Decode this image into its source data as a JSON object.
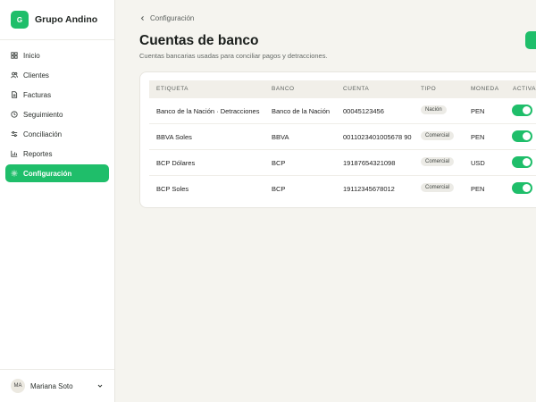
{
  "brand": {
    "logo_letter": "G",
    "name": "Grupo Andino",
    "accent": "#1fbe6a"
  },
  "sidebar": {
    "items": [
      {
        "label": "Inicio",
        "icon": "grid-icon",
        "active": false
      },
      {
        "label": "Clientes",
        "icon": "users-icon",
        "active": false
      },
      {
        "label": "Facturas",
        "icon": "file-icon",
        "active": false
      },
      {
        "label": "Seguimiento",
        "icon": "clock-icon",
        "active": false
      },
      {
        "label": "Conciliación",
        "icon": "sliders-icon",
        "active": false
      },
      {
        "label": "Reportes",
        "icon": "bar-chart-icon",
        "active": false
      },
      {
        "label": "Configuración",
        "icon": "gear-icon",
        "active": true
      }
    ],
    "user": {
      "initials": "MA",
      "name": "Mariana Soto"
    }
  },
  "header": {
    "breadcrumb": "Configuración",
    "title": "Cuentas de banco",
    "subtitle": "Cuentas bancarias usadas para conciliar pagos y detracciones."
  },
  "table": {
    "columns": [
      "ETIQUETA",
      "BANCO",
      "CUENTA",
      "TIPO",
      "MONEDA",
      "ACTIVA"
    ],
    "rows": [
      {
        "etiqueta": "Banco de la Nación · Detracciones",
        "banco": "Banco de la Nación",
        "cuenta": "00045123456",
        "tipo": "Nación",
        "moneda": "PEN",
        "activa": true
      },
      {
        "etiqueta": "BBVA Soles",
        "banco": "BBVA",
        "cuenta": "0011023401005678 90",
        "tipo": "Comercial",
        "moneda": "PEN",
        "activa": true
      },
      {
        "etiqueta": "BCP Dólares",
        "banco": "BCP",
        "cuenta": "19187654321098",
        "tipo": "Comercial",
        "moneda": "USD",
        "activa": true
      },
      {
        "etiqueta": "BCP Soles",
        "banco": "BCP",
        "cuenta": "19112345678012",
        "tipo": "Comercial",
        "moneda": "PEN",
        "activa": true
      }
    ]
  }
}
